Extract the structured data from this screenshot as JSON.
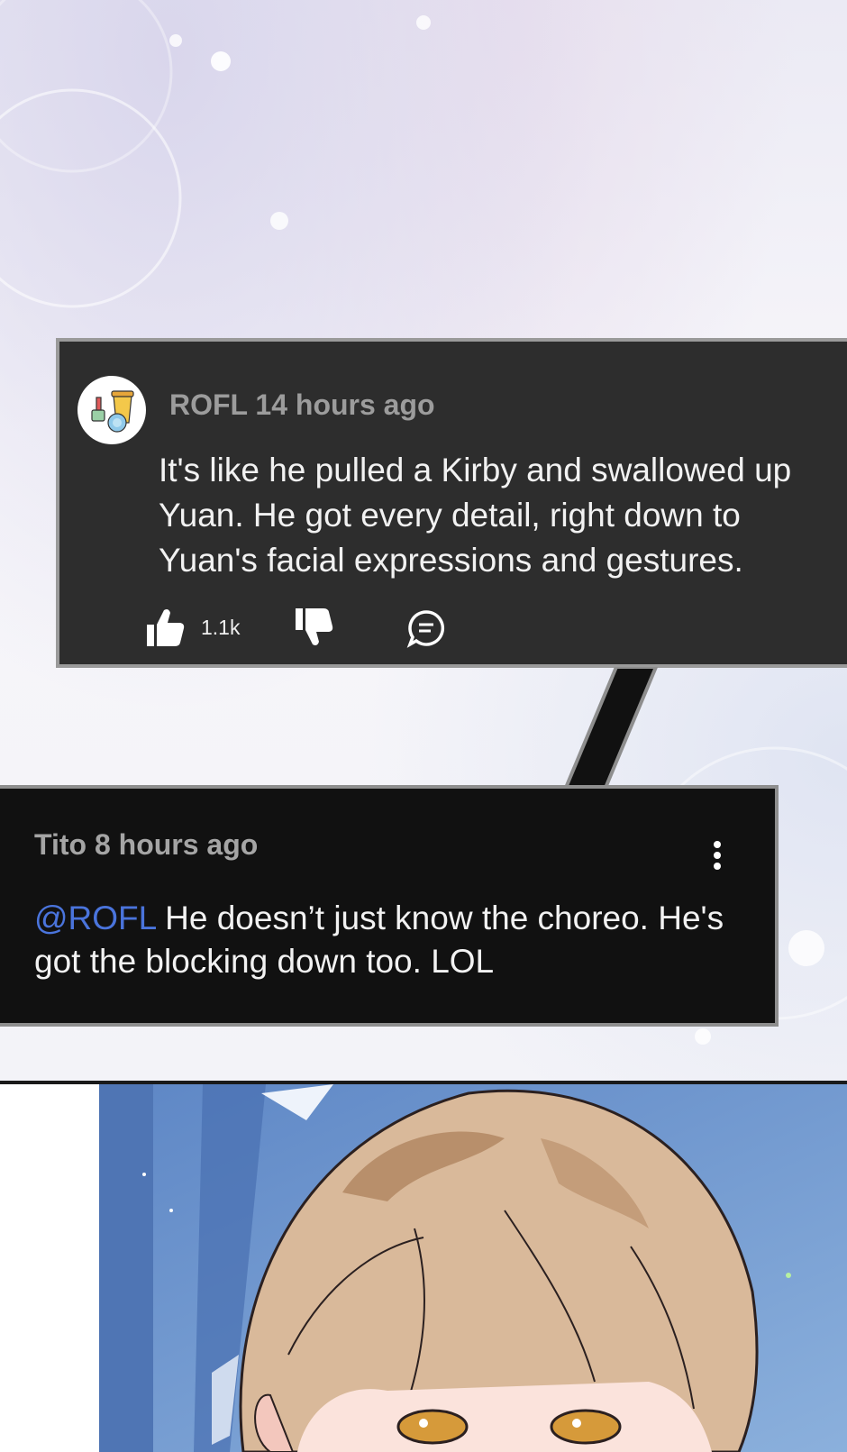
{
  "comments": [
    {
      "author": "ROFL",
      "time": "14 hours ago",
      "text": "It's like he pulled a Kirby and swallowed up Yuan. He got every detail, right down to Yuan's facial expressions and gestures.",
      "likes": "1.1k",
      "icons": {
        "like": "thumbs-up-icon",
        "dislike": "thumbs-down-icon",
        "reply": "comment-bubble-icon"
      }
    },
    {
      "author": "Tito",
      "time": "8 hours ago",
      "mention": "@ROFL",
      "text": " He doesn’t just know the choreo. He's got the blocking down too. LOL",
      "menu_icon": "more-vertical-icon"
    }
  ],
  "colors": {
    "comment_a_bg": "#2d2d2d",
    "comment_b_bg": "#111111",
    "mention": "#4a74dc",
    "meta_text": "#9c9c9c"
  }
}
